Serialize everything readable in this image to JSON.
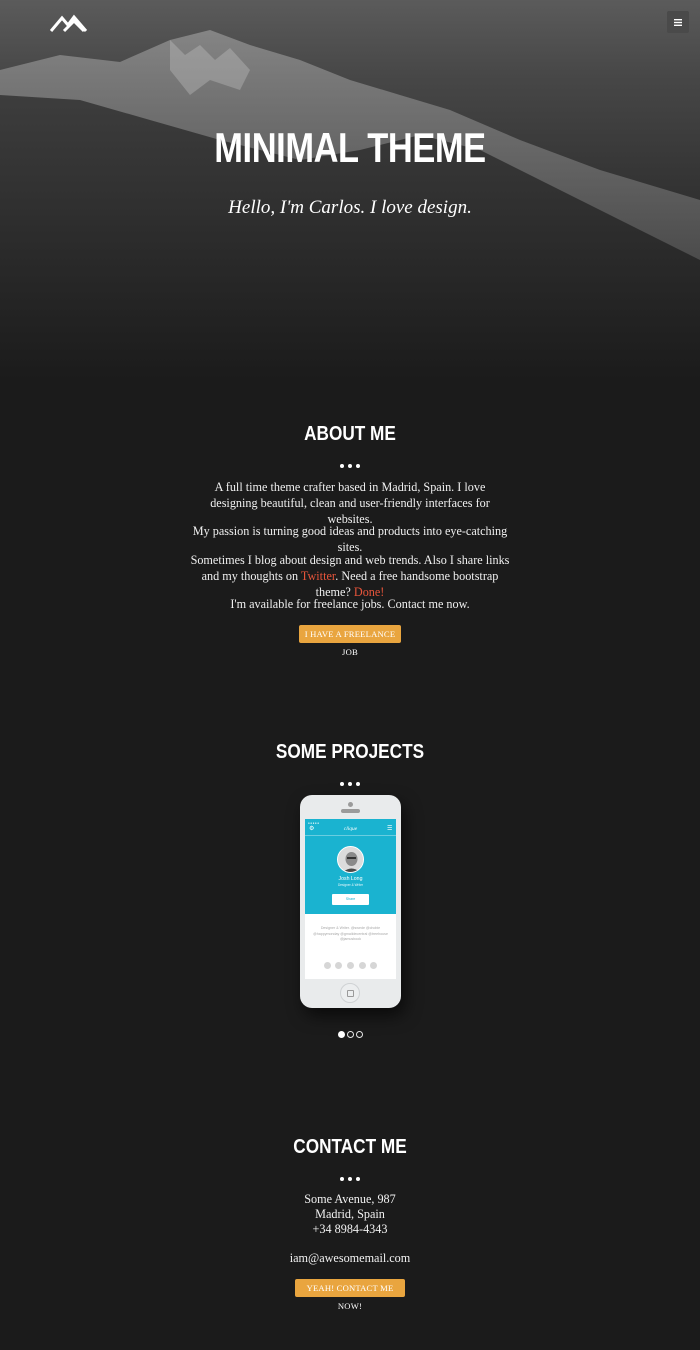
{
  "header": {
    "logo_icon": "mountain-logo-icon",
    "menu_icon": "hamburger-menu-icon"
  },
  "hero": {
    "title": "MINIMAL THEME",
    "subtitle": "Hello, I'm Carlos. I love design."
  },
  "about": {
    "title": "ABOUT ME",
    "p1": "A full time theme crafter based in Madrid, Spain. I love designing beautiful, clean and user-friendly interfaces for websites.",
    "p2": "My passion is turning good ideas and products into eye-catching sites.",
    "p3_before": "Sometimes I blog about design and web trends. Also I share links and my thoughts on ",
    "p3_link1": "Twitter",
    "p3_middle": ". Need a free handsome bootstrap theme? ",
    "p3_link2": "Done!",
    "p4": "I'm available for freelance jobs. Contact me now.",
    "button": "I HAVE A FREELANCE JOB"
  },
  "projects": {
    "title": "SOME PROJECTS",
    "app_brand": "clique",
    "app_status": "●●●●●",
    "profile_name": "Josh Long",
    "profile_role": "Designer & Writer",
    "profile_button": "Share",
    "profile_bio": "Designer & Writer. @swede @chobie @happymonday @gmaildecentral @treehouse @jamusbook",
    "slides_total": 3,
    "slide_active": 1
  },
  "contact": {
    "title": "CONTACT ME",
    "address_line1": "Some Avenue, 987",
    "address_line2": "Madrid, Spain",
    "phone": "+34 8984-4343",
    "email": "iam@awesomemail.com",
    "button": "YEAH! CONTACT ME NOW!"
  },
  "colors": {
    "background": "#1b1b1b",
    "accent_button": "#e9a53f",
    "link": "#e8553b",
    "app_blue": "#1ab3d0"
  }
}
